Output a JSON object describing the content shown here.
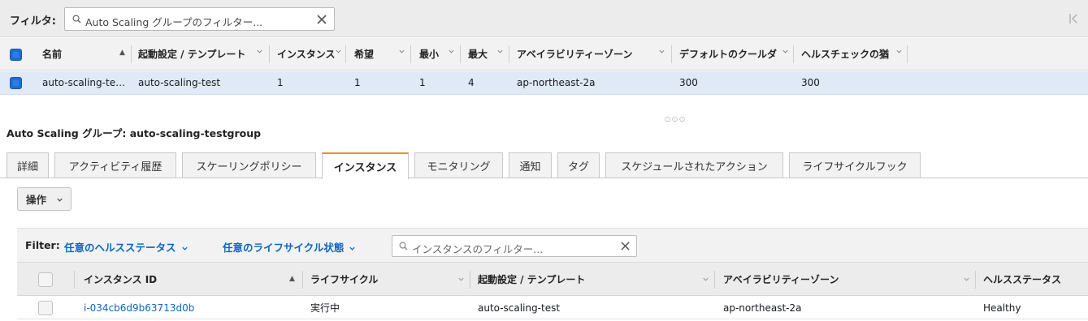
{
  "filter_bar": {
    "label": "フィルタ:",
    "placeholder": "Auto Scaling グループのフィルター..."
  },
  "group_table": {
    "columns": [
      {
        "label": "名前",
        "sort": "▲"
      },
      {
        "label": "起動設定 / テンプレート"
      },
      {
        "label": "インスタンス"
      },
      {
        "label": "希望"
      },
      {
        "label": "最小"
      },
      {
        "label": "最大"
      },
      {
        "label": "アベイラビリティーゾーン"
      },
      {
        "label": "デフォルトのクールダ"
      },
      {
        "label": "ヘルスチェックの猶"
      }
    ],
    "rows": [
      {
        "name": "auto-scaling-te…",
        "launch_config": "auto-scaling-test",
        "instances": "1",
        "desired": "1",
        "min": "1",
        "max": "4",
        "az": "ap-northeast-2a",
        "cooldown": "300",
        "health_grace": "300"
      }
    ]
  },
  "details": {
    "title": "Auto Scaling グループ: auto-scaling-testgroup",
    "tabs": [
      {
        "label": "詳細"
      },
      {
        "label": "アクティビティ履歴"
      },
      {
        "label": "スケーリングポリシー"
      },
      {
        "label": "インスタンス",
        "active": true
      },
      {
        "label": "モニタリング"
      },
      {
        "label": "通知"
      },
      {
        "label": "タグ"
      },
      {
        "label": "スケジュールされたアクション"
      },
      {
        "label": "ライフサイクルフック"
      }
    ],
    "action_label": "操作"
  },
  "instance_filter": {
    "label": "Filter:",
    "health_filter": "任意のヘルスステータス",
    "lifecycle_filter": "任意のライフサイクル状態",
    "search_placeholder": "インスタンスのフィルター..."
  },
  "instance_table": {
    "columns": [
      {
        "label": "インスタンス ID",
        "sort": "▲"
      },
      {
        "label": "ライフサイクル"
      },
      {
        "label": "起動設定 / テンプレート"
      },
      {
        "label": "アベイラビリティーゾーン"
      },
      {
        "label": "ヘルスステータス"
      }
    ],
    "rows": [
      {
        "instance_id": "i-034cb6d9b63713d0b",
        "lifecycle": "実行中",
        "launch_config": "auto-scaling-test",
        "az": "ap-northeast-2a",
        "health": "Healthy"
      }
    ]
  },
  "colors": {
    "accent_tab": "#e8912d",
    "link": "#0b66c2",
    "selected_row": "#dfeaf6",
    "checkbox_selected": "#1f6fd1"
  }
}
